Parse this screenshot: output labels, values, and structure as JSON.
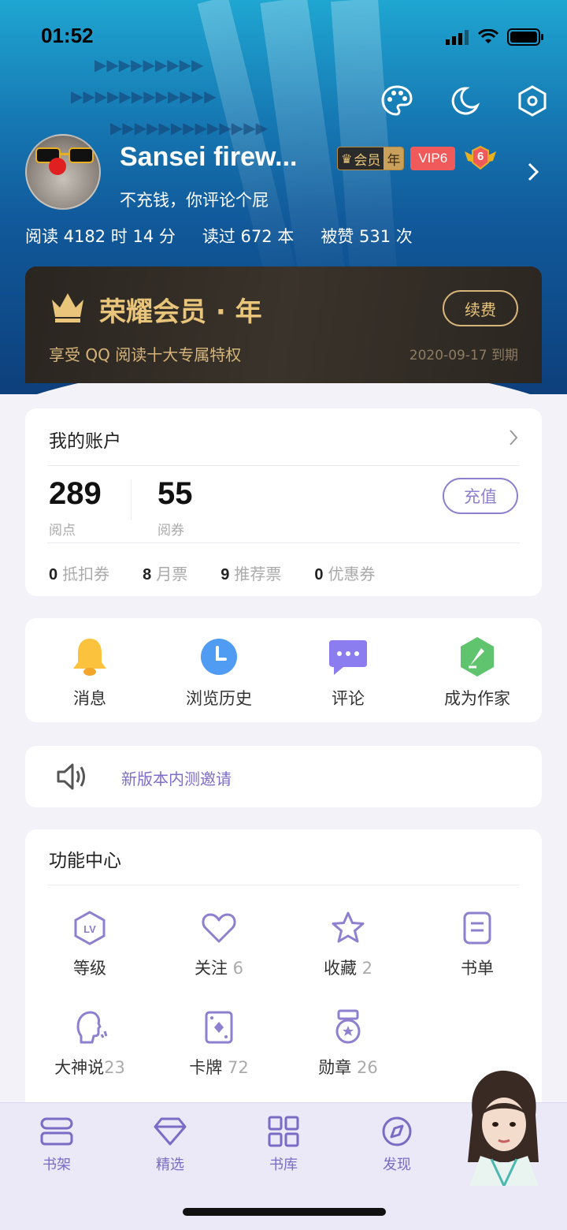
{
  "status_bar": {
    "time": "01:52"
  },
  "profile": {
    "username": "Sansei firew...",
    "member_badge": "会员",
    "member_badge_year": "年",
    "vip_badge": "VIP6",
    "level_badge": "6",
    "motto": "不充钱，你评论个屁",
    "stats": [
      "阅读 4182 时 14 分",
      "读过 672 本",
      "被赞 531 次"
    ]
  },
  "membership": {
    "title": "荣耀会员 · 年",
    "subtitle": "享受 QQ 阅读十大专属特权",
    "expire": "2020-09-17 到期",
    "renew_label": "续费"
  },
  "account": {
    "title": "我的账户",
    "points_value": "289",
    "points_unit": "阅点",
    "tickets_value": "55",
    "tickets_unit": "阅券",
    "topup_label": "充值",
    "coupons": [
      {
        "count": "0",
        "label": "抵扣券"
      },
      {
        "count": "8",
        "label": "月票"
      },
      {
        "count": "9",
        "label": "推荐票"
      },
      {
        "count": "0",
        "label": "优惠券"
      }
    ]
  },
  "quick_actions": [
    {
      "label": "消息",
      "icon": "bell-icon"
    },
    {
      "label": "浏览历史",
      "icon": "clock-icon"
    },
    {
      "label": "评论",
      "icon": "chat-icon"
    },
    {
      "label": "成为作家",
      "icon": "pen-icon"
    }
  ],
  "notice": {
    "text": "新版本内测邀请"
  },
  "function_center": {
    "title": "功能中心",
    "items": [
      {
        "label": "等级",
        "count": "",
        "icon": "level-icon"
      },
      {
        "label": "关注",
        "count": "6",
        "icon": "heart-icon"
      },
      {
        "label": "收藏",
        "count": "2",
        "icon": "star-icon"
      },
      {
        "label": "书单",
        "count": "",
        "icon": "list-icon"
      },
      {
        "label": "大神说",
        "count": "23",
        "icon": "talk-icon"
      },
      {
        "label": "卡牌",
        "count": "72",
        "icon": "card-icon"
      },
      {
        "label": "勋章",
        "count": "26",
        "icon": "medal-icon"
      }
    ]
  },
  "tabbar": [
    {
      "label": "书架",
      "icon": "bookshelf-icon"
    },
    {
      "label": "精选",
      "icon": "diamond-icon"
    },
    {
      "label": "书库",
      "icon": "grid-icon"
    },
    {
      "label": "发现",
      "icon": "compass-icon"
    }
  ],
  "colors": {
    "accent": "#8e7fcf",
    "gold": "#e8c57a",
    "vip_red": "#f05a5a"
  }
}
